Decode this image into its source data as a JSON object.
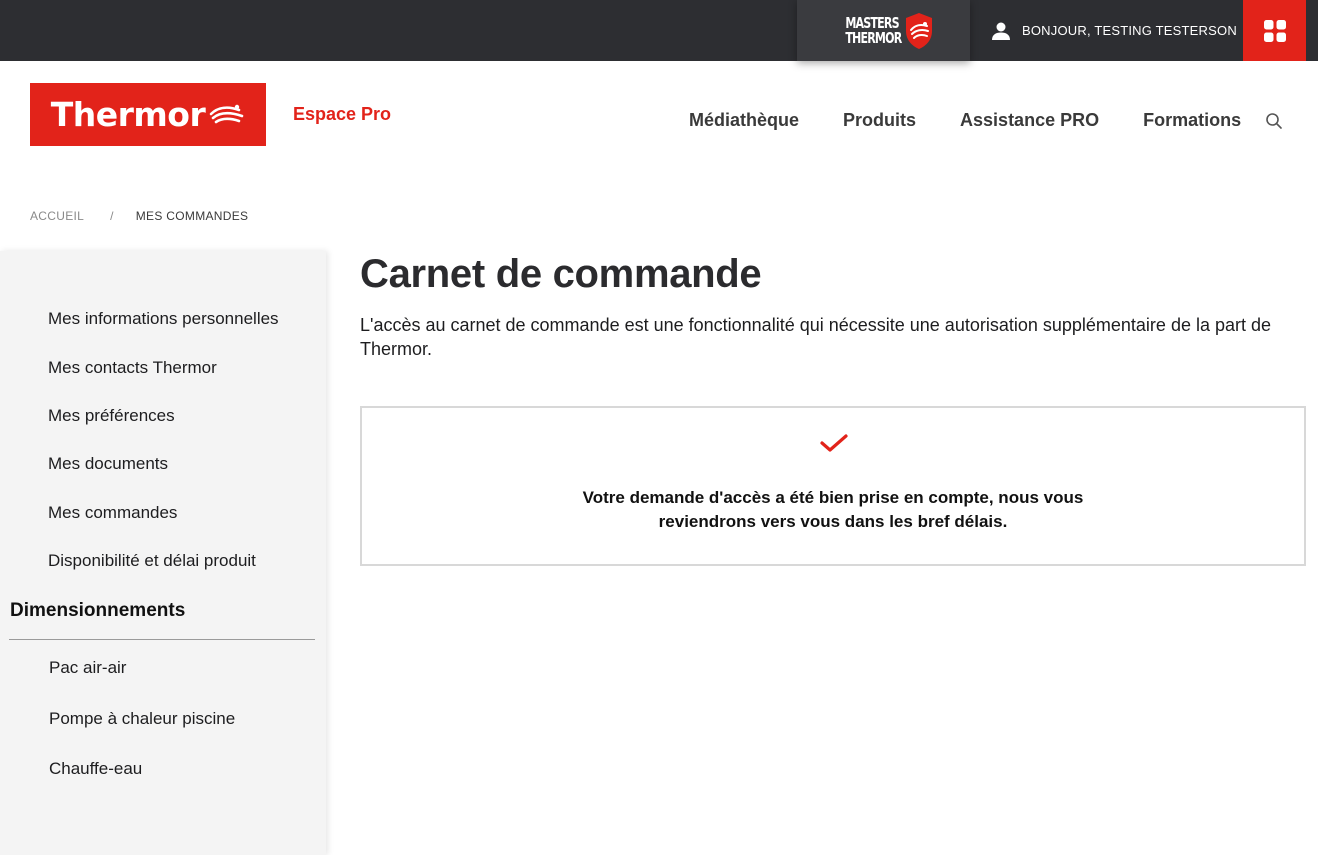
{
  "topbar": {
    "masters_logo": [
      "MASTERS",
      "THERMOR"
    ],
    "greeting": "BONJOUR, TESTING TESTERSON",
    "user_icon": "user-icon",
    "apps_icon": "apps-grid-icon"
  },
  "header": {
    "brand": "Thermor",
    "espace_pro": "Espace Pro",
    "nav": [
      "Médiathèque",
      "Produits",
      "Assistance PRO",
      "Formations"
    ],
    "search_icon": "search-icon"
  },
  "breadcrumb": {
    "home": "ACCUEIL",
    "separator": "/",
    "current": "MES COMMANDES"
  },
  "sidebar": {
    "items": [
      "Mes informations personnelles",
      "Mes contacts Thermor",
      "Mes préférences",
      "Mes documents",
      "Mes commandes",
      "Disponibilité et délai produit"
    ],
    "section_title": "Dimensionnements",
    "sub_items": [
      "Pac air-air",
      "Pompe à chaleur piscine",
      "Chauffe-eau"
    ]
  },
  "main": {
    "title": "Carnet de commande",
    "intro": "L'accès au carnet de commande est une fonctionnalité qui nécessite une autorisation supplémentaire de la part de Thermor.",
    "notice": {
      "icon": "checkmark-icon",
      "line1": "Votre demande d'accès a été bien prise en compte, nous vous",
      "line2": "reviendrons vers vous dans les bref délais."
    }
  },
  "colors": {
    "brand_red": "#e2231a",
    "topbar_bg": "#2d2e32",
    "sidebar_bg": "#f4f4f4"
  }
}
